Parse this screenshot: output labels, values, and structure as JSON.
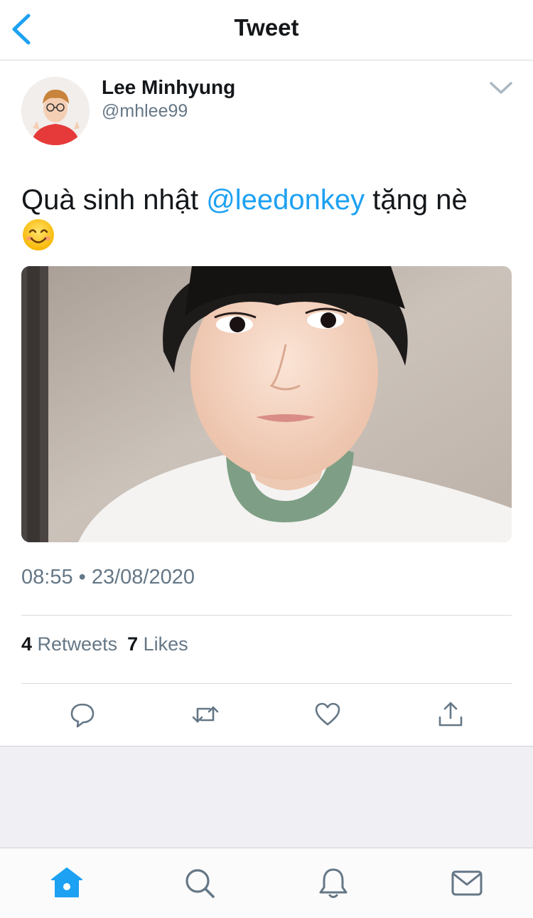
{
  "header": {
    "title": "Tweet",
    "back_icon": "chevron-left-icon"
  },
  "author": {
    "name": "Lee Minhyung",
    "handle": "@mhlee99"
  },
  "tweet": {
    "text_before": "Quà sinh nhật ",
    "mention": "@leedonkey",
    "text_after": " tặng nè",
    "emoji_icon": "smiling-face-emoji",
    "timestamp": "08:55 • 23/08/2020"
  },
  "stats": {
    "retweets_count": "4",
    "retweets_label": "Retweets",
    "likes_count": "7",
    "likes_label": "Likes"
  },
  "actions": [
    "reply-icon",
    "retweet-icon",
    "like-icon",
    "share-icon"
  ],
  "tabbar": [
    "home-icon",
    "search-icon",
    "notifications-icon",
    "messages-icon"
  ],
  "colors": {
    "accent": "#1da1f2",
    "secondary_text": "#657786",
    "primary_text": "#14171a",
    "background_gray": "#efeff4"
  }
}
